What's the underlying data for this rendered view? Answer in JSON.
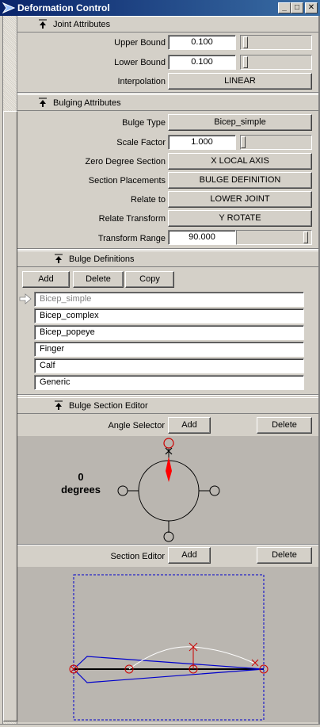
{
  "window": {
    "title": "Deformation Control",
    "buttons": {
      "minimize": "_",
      "maximize": "□",
      "close": "✕"
    }
  },
  "joint_attributes": {
    "header": "Joint Attributes",
    "upper_bound_label": "Upper Bound",
    "upper_bound_value": "0.100",
    "lower_bound_label": "Lower Bound",
    "lower_bound_value": "0.100",
    "interpolation_label": "Interpolation",
    "interpolation_value": "LINEAR"
  },
  "bulging_attributes": {
    "header": "Bulging Attributes",
    "bulge_type_label": "Bulge Type",
    "bulge_type_value": "Bicep_simple",
    "scale_factor_label": "Scale Factor",
    "scale_factor_value": "1.000",
    "zero_degree_label": "Zero Degree Section",
    "zero_degree_value": "X LOCAL AXIS",
    "section_placements_label": "Section Placements",
    "section_placements_value": "BULGE DEFINITION",
    "relate_to_label": "Relate to",
    "relate_to_value": "LOWER JOINT",
    "relate_transform_label": "Relate Transform",
    "relate_transform_value": "Y ROTATE",
    "transform_range_label": "Transform Range",
    "transform_range_value": "90.000"
  },
  "bulge_definitions": {
    "header": "Bulge Definitions",
    "add_label": "Add",
    "delete_label": "Delete",
    "copy_label": "Copy",
    "items": [
      "Bicep_simple",
      "Bicep_complex",
      "Bicep_popeye",
      "Finger",
      "Calf",
      "Generic"
    ]
  },
  "bulge_section_editor": {
    "header": "Bulge Section Editor",
    "angle_selector_label": "Angle Selector",
    "angle_add_label": "Add",
    "angle_delete_label": "Delete",
    "angle_value": "0",
    "angle_units": "degrees",
    "section_editor_label": "Section Editor",
    "section_add_label": "Add",
    "section_delete_label": "Delete"
  },
  "colors": {
    "title_bar": "#0a246a",
    "panel": "#d4d0c8",
    "canvas": "#bab6b0",
    "handle_red": "#cc0000",
    "curve_blue": "#0000cc"
  }
}
